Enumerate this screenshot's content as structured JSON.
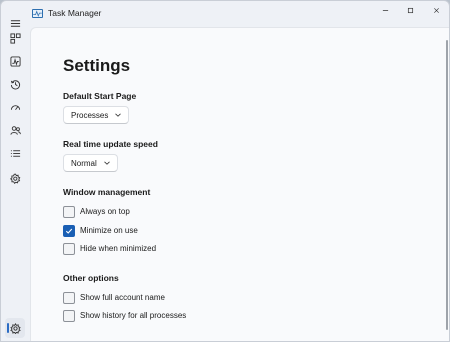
{
  "window": {
    "title": "Task Manager",
    "controls": {
      "minimize": "–",
      "maximize": "□",
      "close": "✕"
    }
  },
  "sidebar": {
    "items": [
      {
        "icon": "hamburger-menu-icon"
      },
      {
        "icon": "processes-icon"
      },
      {
        "icon": "performance-icon"
      },
      {
        "icon": "app-history-icon"
      },
      {
        "icon": "startup-apps-icon"
      },
      {
        "icon": "users-icon"
      },
      {
        "icon": "details-icon"
      },
      {
        "icon": "services-icon"
      },
      {
        "icon": "settings-icon",
        "active": true
      }
    ]
  },
  "settings": {
    "title": "Settings",
    "default_start_page": {
      "label": "Default Start Page",
      "value": "Processes"
    },
    "update_speed": {
      "label": "Real time update speed",
      "value": "Normal"
    },
    "window_management": {
      "label": "Window management",
      "options": [
        {
          "label": "Always on top",
          "checked": false
        },
        {
          "label": "Minimize on use",
          "checked": true
        },
        {
          "label": "Hide when minimized",
          "checked": false
        }
      ]
    },
    "other_options": {
      "label": "Other options",
      "options": [
        {
          "label": "Show full account name",
          "checked": false
        },
        {
          "label": "Show history for all processes",
          "checked": false
        }
      ]
    }
  },
  "colors": {
    "accent": "#1a5fb4",
    "active_indicator": "#2b6cc4"
  }
}
